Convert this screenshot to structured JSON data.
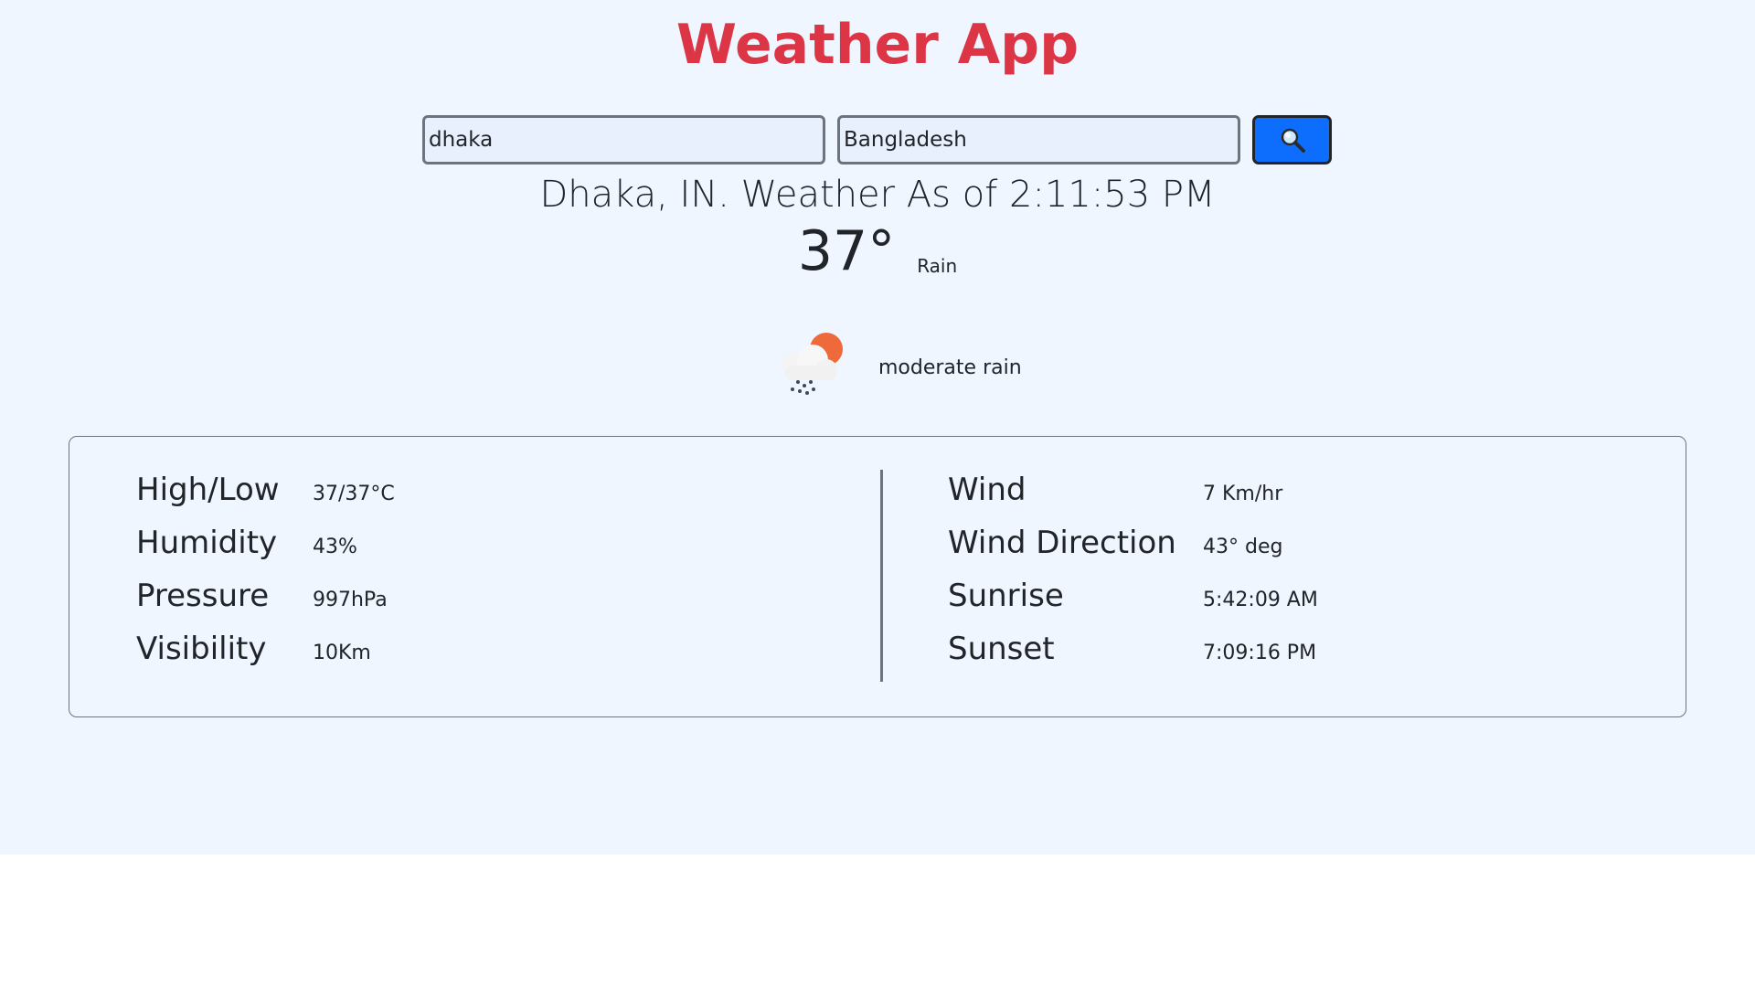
{
  "app": {
    "title": "Weather App"
  },
  "search": {
    "city_value": "dhaka",
    "country_value": "Bangladesh",
    "button_icon": "search-icon"
  },
  "current": {
    "headline": "Dhaka, IN. Weather As of 2:11:53 PM",
    "temperature": "37°",
    "main": "Rain",
    "description": "moderate rain",
    "icon": "rain-cloud-sun-icon"
  },
  "details": {
    "left": [
      {
        "label": "High/Low",
        "value": "37/37°C"
      },
      {
        "label": "Humidity",
        "value": "43%"
      },
      {
        "label": "Pressure",
        "value": "997hPa"
      },
      {
        "label": "Visibility",
        "value": "10Km"
      }
    ],
    "right": [
      {
        "label": "Wind",
        "value": "7 Km/hr"
      },
      {
        "label": "Wind Direction",
        "value": "43° deg"
      },
      {
        "label": "Sunrise",
        "value": "5:42:09 AM"
      },
      {
        "label": "Sunset",
        "value": "7:09:16 PM"
      }
    ]
  },
  "colors": {
    "title": "#dc3545",
    "background": "#eff6ff",
    "button": "#0d6efd",
    "input_bg": "#e8f0fe"
  }
}
